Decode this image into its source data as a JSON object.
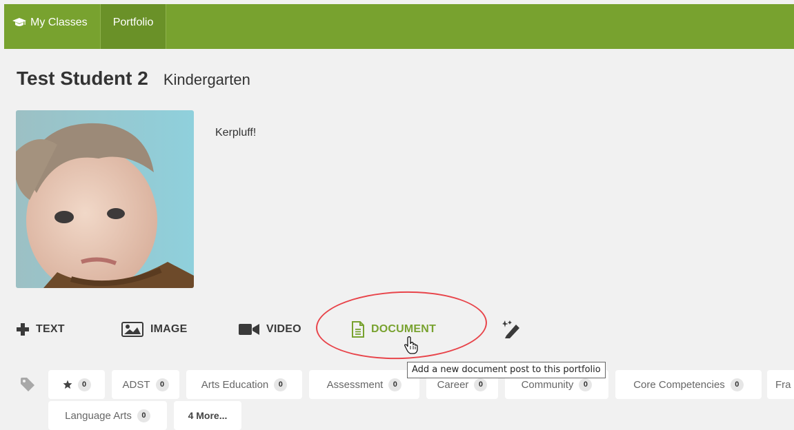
{
  "nav": {
    "items": [
      {
        "label": "My Classes",
        "icon": "graduation-cap-icon"
      },
      {
        "label": "Portfolio"
      }
    ],
    "color": "#78a22f"
  },
  "student": {
    "name": "Test Student 2",
    "grade": "Kindergarten",
    "bio": "Kerpluff!"
  },
  "post_types": [
    {
      "label": "TEXT",
      "icon": "plus-icon"
    },
    {
      "label": "IMAGE",
      "icon": "image-icon"
    },
    {
      "label": "VIDEO",
      "icon": "video-camera-icon"
    },
    {
      "label": "DOCUMENT",
      "icon": "document-icon",
      "highlight_color": "#78a22f"
    },
    {
      "label": "",
      "icon": "magic-wand-pencil-icon"
    }
  ],
  "tooltip": "Add a new document post to this portfolio",
  "tags": [
    {
      "label": "",
      "icon": "star-icon",
      "count": "0"
    },
    {
      "label": "ADST",
      "count": "0"
    },
    {
      "label": "Arts Education",
      "count": "0"
    },
    {
      "label": "Assessment",
      "count": "0"
    },
    {
      "label": "Career",
      "count": "0"
    },
    {
      "label": "Community",
      "count": "0"
    },
    {
      "label": "Core Competencies",
      "count": "0"
    },
    {
      "label": "Fra"
    },
    {
      "label": "Language Arts",
      "count": "0"
    },
    {
      "label": "4 More..."
    }
  ],
  "annotation_color": "#e8444a"
}
